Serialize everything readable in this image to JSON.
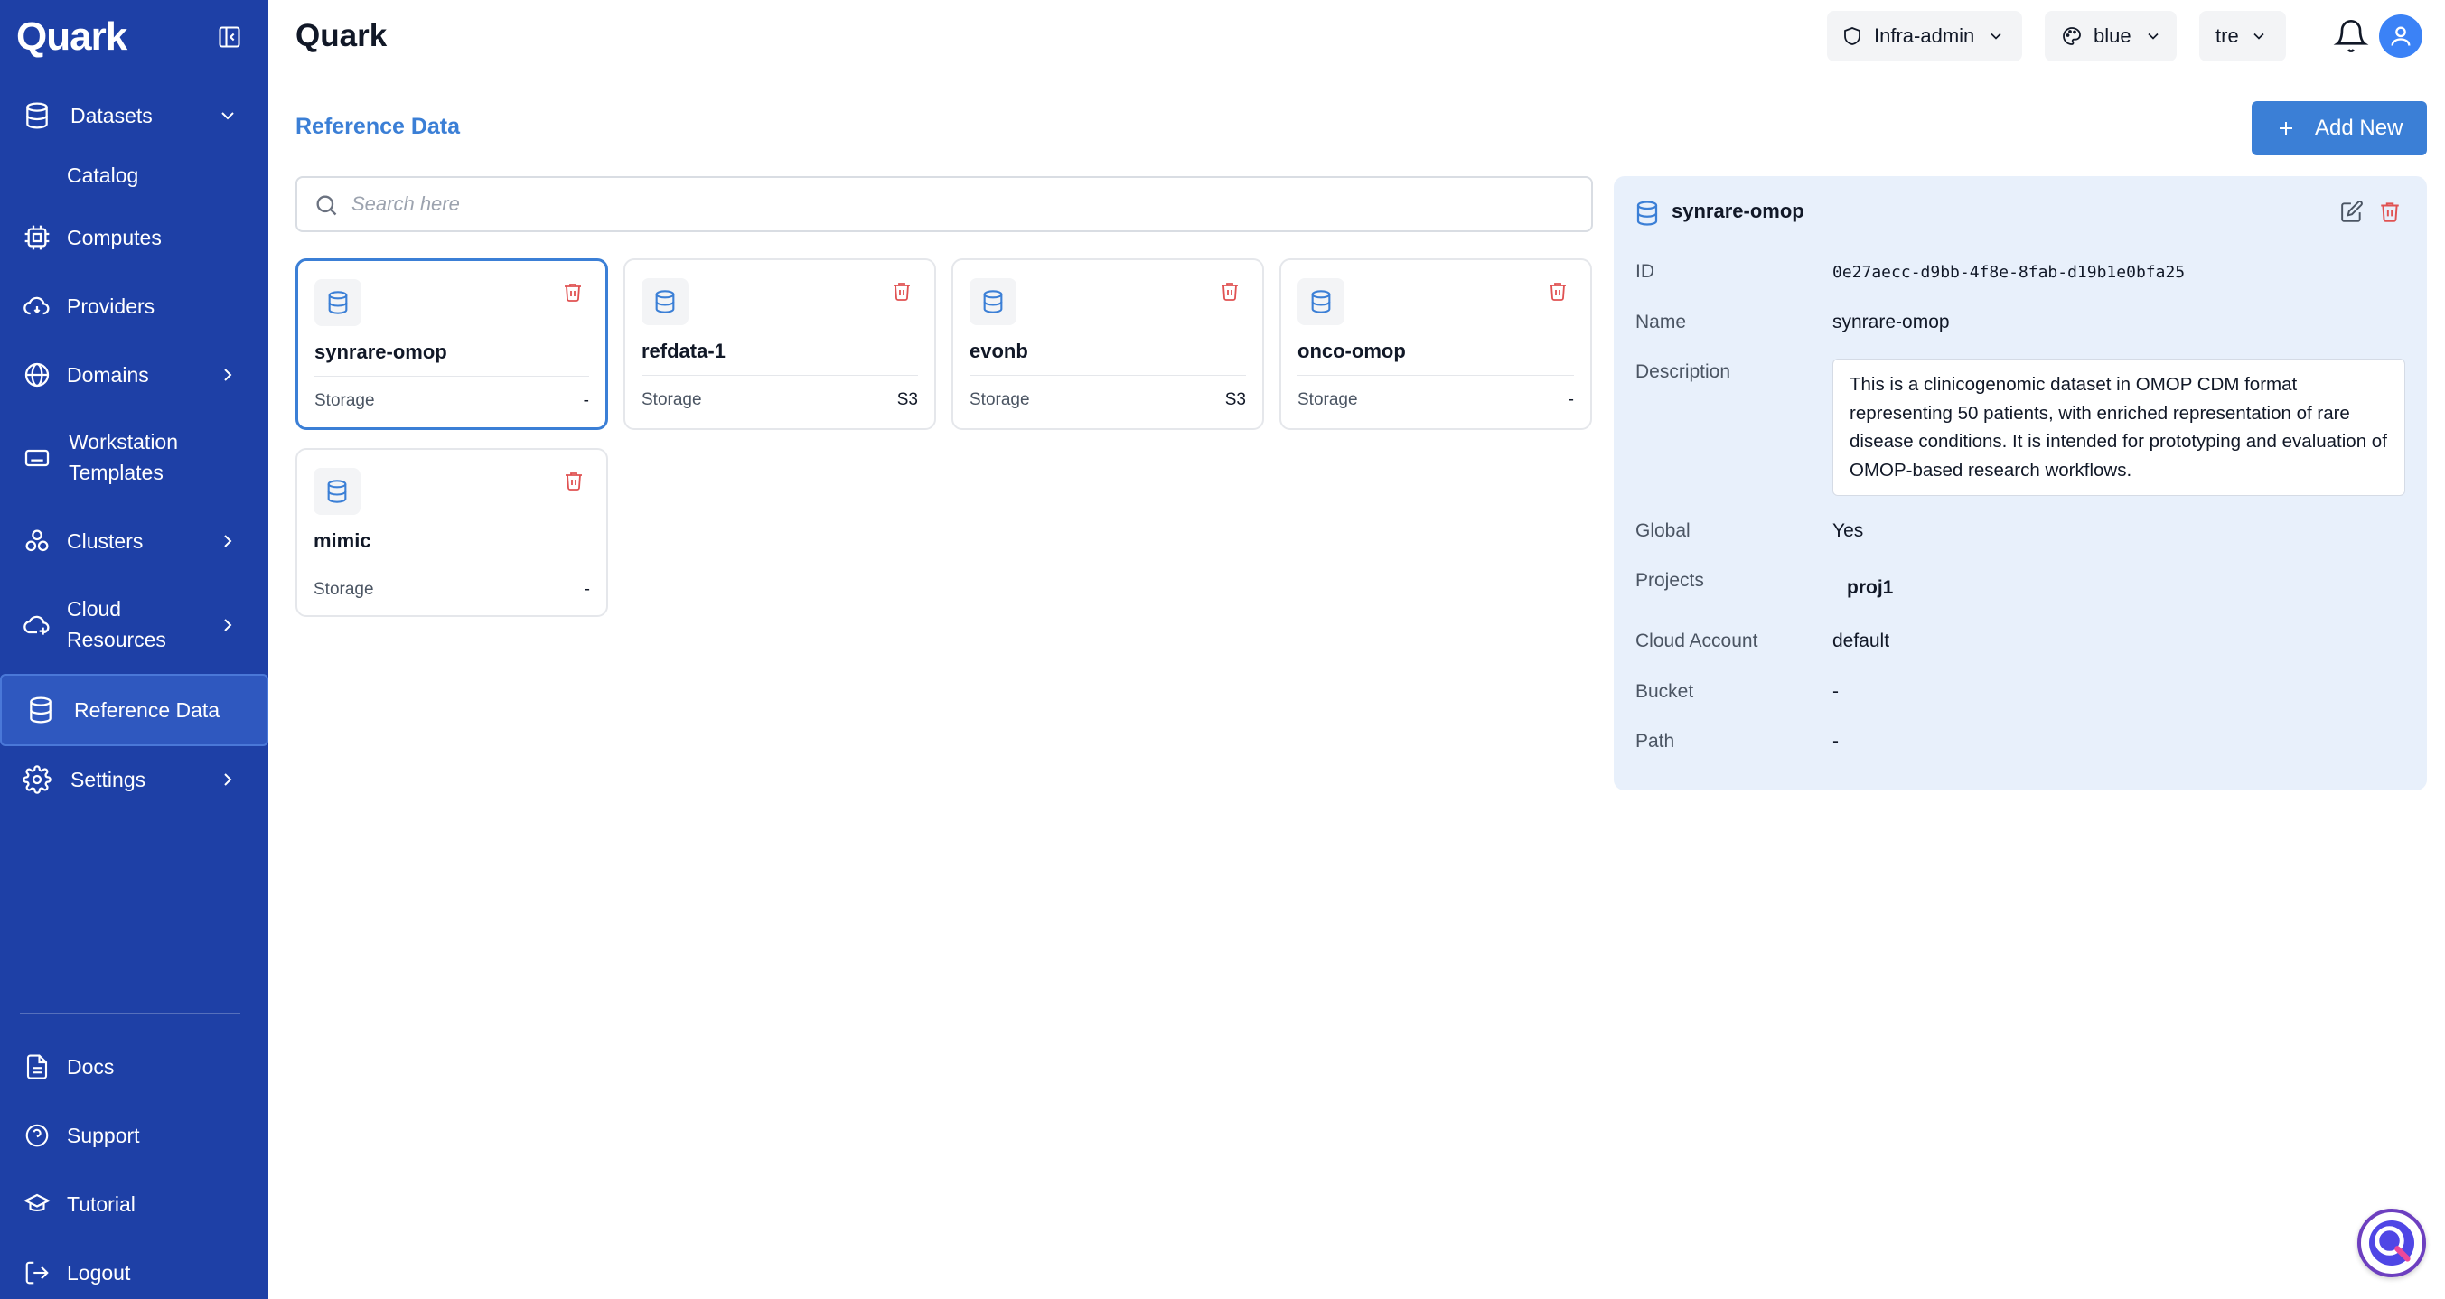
{
  "app": {
    "name": "Quark"
  },
  "sidebar": {
    "items": [
      {
        "label": "Datasets",
        "icon": "database-icon"
      },
      {
        "label": "Catalog"
      },
      {
        "label": "Computes",
        "icon": "cpu-icon"
      },
      {
        "label": "Providers",
        "icon": "cloud-sync-icon"
      },
      {
        "label": "Domains",
        "icon": "globe-icon"
      },
      {
        "label": "Workstation",
        "label2": "Templates",
        "icon": "keyboard-icon"
      },
      {
        "label": "Clusters",
        "icon": "cluster-icon"
      },
      {
        "label": "Cloud",
        "label2": "Resources",
        "icon": "cloud-plus-icon"
      },
      {
        "label": "Reference Data",
        "icon": "database-icon"
      },
      {
        "label": "Settings",
        "icon": "gear-icon"
      }
    ],
    "footer": [
      {
        "label": "Docs",
        "icon": "document-icon"
      },
      {
        "label": "Support",
        "icon": "help-circle-icon"
      },
      {
        "label": "Tutorial",
        "icon": "graduation-cap-icon"
      },
      {
        "label": "Logout",
        "icon": "logout-icon"
      }
    ]
  },
  "header": {
    "title": "Quark",
    "role": "Infra-admin",
    "theme": "blue",
    "workspace": "tre"
  },
  "main": {
    "title": "Reference Data",
    "add_label": "Add New",
    "search_placeholder": "Search here",
    "cards": [
      {
        "name": "synrare-omop",
        "key": "Storage",
        "value": "-"
      },
      {
        "name": "refdata-1",
        "key": "Storage",
        "value": "S3"
      },
      {
        "name": "evonb",
        "key": "Storage",
        "value": "S3"
      },
      {
        "name": "onco-omop",
        "key": "Storage",
        "value": "-"
      },
      {
        "name": "mimic",
        "key": "Storage",
        "value": "-"
      }
    ]
  },
  "detail": {
    "title": "synrare-omop",
    "labels": {
      "id": "ID",
      "name": "Name",
      "description": "Description",
      "global": "Global",
      "projects": "Projects",
      "cloud_account": "Cloud Account",
      "bucket": "Bucket",
      "path": "Path"
    },
    "values": {
      "id": "0e27aecc-d9bb-4f8e-8fab-d19b1e0bfa25",
      "name": "synrare-omop",
      "description": "This is a clinicogenomic dataset in OMOP CDM format representing 50 patients, with enriched representation of rare disease conditions. It is intended for prototyping and evaluation of OMOP-based research workflows.",
      "global": "Yes",
      "project": "proj1",
      "cloud_account": "default",
      "bucket": "-",
      "path": "-"
    }
  },
  "colors": {
    "sidebar": "#1e40a6",
    "accent": "#3b7fd6",
    "danger": "#e05252",
    "panel": "#e8f0fb"
  }
}
